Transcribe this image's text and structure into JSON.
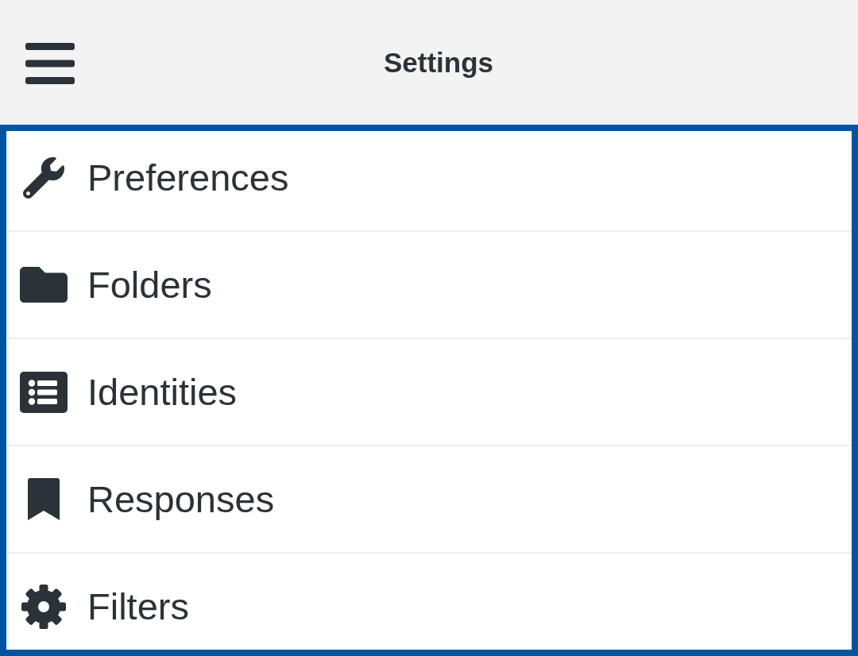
{
  "header": {
    "title": "Settings"
  },
  "settings": [
    {
      "label": "Preferences"
    },
    {
      "label": "Folders"
    },
    {
      "label": "Identities"
    },
    {
      "label": "Responses"
    },
    {
      "label": "Filters"
    }
  ]
}
